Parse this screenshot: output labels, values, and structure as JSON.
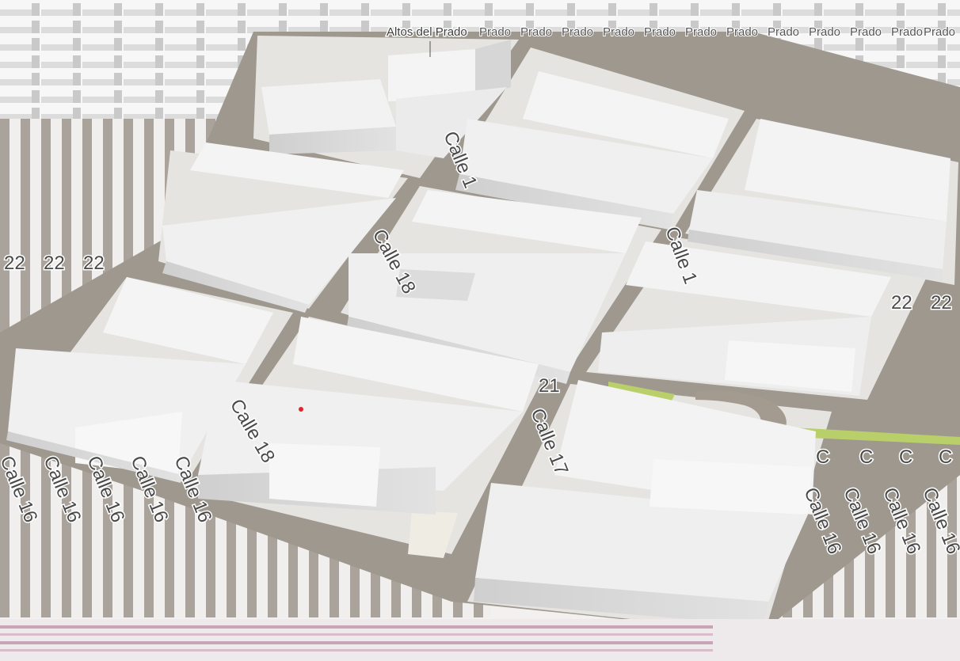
{
  "map": {
    "place_label": "Altos del Prado",
    "place_repeat": "Prado",
    "streets": {
      "calle_16": "Calle 16",
      "calle_17": "Calle 17",
      "calle_18": "Calle 18",
      "calle_16_fragment": "Calle 1",
      "calle_17_fragment": "Calle 1",
      "calle_18_fragment": "Calle 18",
      "label_21": "21",
      "label_22": "22",
      "label_c": "C"
    }
  },
  "colors": {
    "background": "#f4f3f2",
    "road": "#a39d95",
    "road_edge": "#8b857d",
    "building_top": "#f2f2f2",
    "building_side": "#d4d4d4",
    "building_shade": "#bdbdbd",
    "park": "#b8cf6a",
    "plaza": "#efece4",
    "marker": "#e0262c",
    "glitch_pink": "#c9a3b8"
  }
}
